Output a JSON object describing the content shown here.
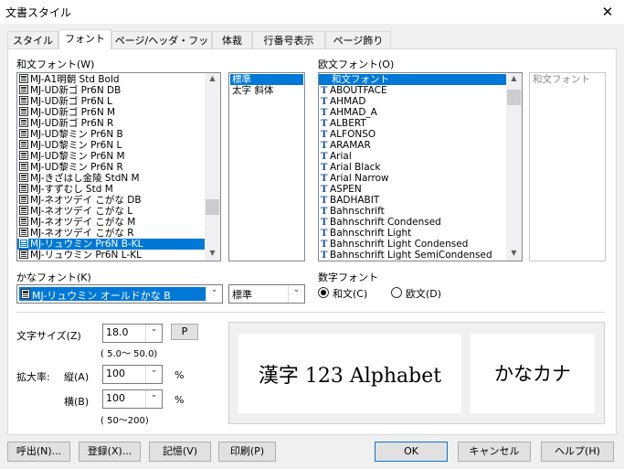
{
  "window": {
    "title": "文書スタイル",
    "close_symbol": "✕"
  },
  "tabs": [
    "スタイル",
    "フォント",
    "ページ/ヘッダ・フッタ",
    "体裁",
    "行番号表示",
    "ページ飾り"
  ],
  "japanese_font": {
    "label": "和文フォント(W)",
    "items": [
      "MJ-A1明朝 Std Bold",
      "MJ-UD新ゴ Pr6N DB",
      "MJ-UD新ゴ Pr6N L",
      "MJ-UD新ゴ Pr6N M",
      "MJ-UD新ゴ Pr6N R",
      "MJ-UD黎ミン Pr6N B",
      "MJ-UD黎ミン Pr6N L",
      "MJ-UD黎ミン Pr6N M",
      "MJ-UD黎ミン Pr6N R",
      "MJ-きざはし金陵 StdN M",
      "MJ-すずむし Std M",
      "MJ-ネオツデイ こがな DB",
      "MJ-ネオツデイ こがな L",
      "MJ-ネオツデイ こがな M",
      "MJ-ネオツデイ こがな R",
      "MJ-リュウミン Pr6N B-KL",
      "MJ-リュウミン Pr6N L-KL"
    ],
    "selected_index": 15
  },
  "style_list": {
    "items": [
      "標準",
      "太字 斜体"
    ],
    "selected_index": 0
  },
  "western_font": {
    "label": "欧文フォント(O)",
    "items": [
      "和文フォント",
      "ABOUTFACE",
      "AHMAD",
      "AHMAD_A",
      "ALBERT",
      "ALFONSO",
      "ARAMAR",
      "Arial",
      "Arial Black",
      "Arial Narrow",
      "ASPEN",
      "BADHABIT",
      "Bahnschrift",
      "Bahnschrift Condensed",
      "Bahnschrift Light",
      "Bahnschrift Light Condensed",
      "Bahnschrift Light SemiCondensed"
    ],
    "selected_index": 0
  },
  "western_style_list": {
    "items": [
      "和文フォント"
    ]
  },
  "kana_font": {
    "label": "かなフォント(K)",
    "value": "MJ-リュウミン オールドかな B",
    "style_value": "標準"
  },
  "number_font": {
    "label": "数字フォント",
    "options": [
      "和文(C)",
      "欧文(D)"
    ],
    "selected_index": 0
  },
  "size": {
    "label": "文字サイズ(Z)",
    "value": "18.0",
    "p_button": "P",
    "range_text": "(      5.0～      50.0)"
  },
  "scale": {
    "label": "拡大率:",
    "vertical_label": "縦(A)",
    "vertical_value": "100",
    "horizontal_label": "横(B)",
    "horizontal_value": "100",
    "unit": "%",
    "range_text": "( 50～200)"
  },
  "preview": {
    "main_text": "漢字 123 Alphabet",
    "kana_text": "かなカナ"
  },
  "buttons": {
    "load": "呼出(N)...",
    "register": "登録(X)...",
    "memory": "記憶(V)",
    "print": "印刷(P)",
    "ok": "OK",
    "cancel": "キャンセル",
    "help": "ヘルプ(H)"
  },
  "colors": {
    "selection": "#0078d7",
    "tab_bg": "#f0f0f0"
  }
}
